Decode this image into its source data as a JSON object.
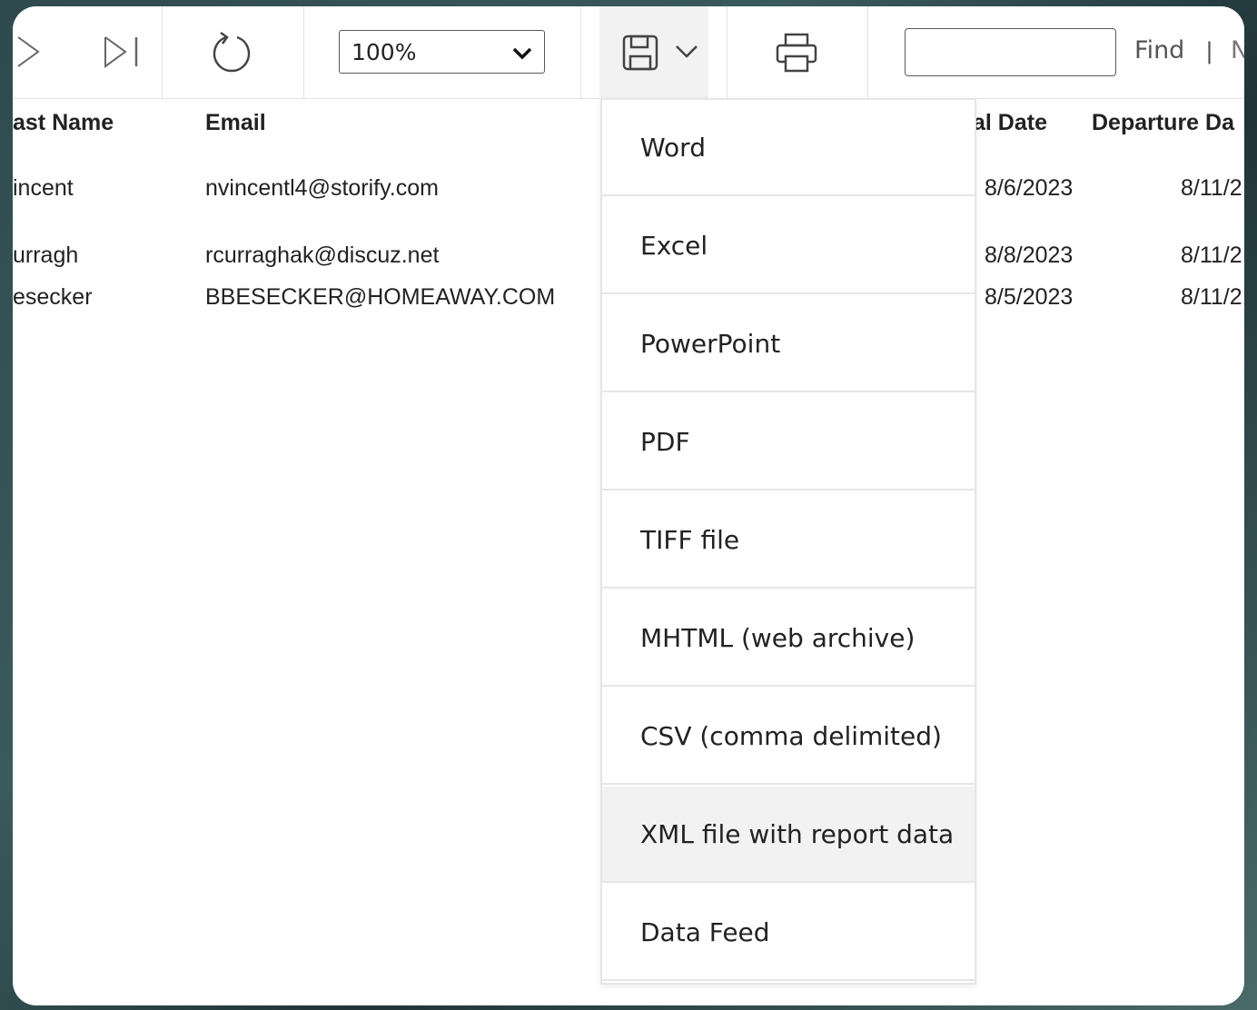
{
  "toolbar": {
    "zoom_value": "100%",
    "find_label": "Find",
    "find_separator": "|",
    "next_label": "N",
    "find_placeholder": ""
  },
  "report": {
    "headers": [
      "ast Name",
      "Email",
      "al Date",
      "Departure Da"
    ],
    "rows": [
      {
        "last_name": "incent",
        "email": "nvincentl4@storify.com",
        "arrival": "8/6/2023",
        "departure": "8/11/2"
      },
      {
        "last_name": "urragh",
        "email": "rcurraghak@discuz.net",
        "arrival": "8/8/2023",
        "departure": "8/11/2"
      },
      {
        "last_name": "esecker",
        "email": "BBESECKER@HOMEAWAY.COM",
        "arrival": "8/5/2023",
        "departure": "8/11/2"
      }
    ]
  },
  "export_menu": {
    "items": [
      "Word",
      "Excel",
      "PowerPoint",
      "PDF",
      "TIFF file",
      "MHTML (web archive)",
      "CSV (comma delimited)",
      "XML file with report data",
      "Data Feed"
    ],
    "highlighted_index": 7
  },
  "icons": {
    "next": "next-page-icon",
    "last": "last-page-icon",
    "refresh": "refresh-icon",
    "save": "save-icon",
    "dropdown": "chevron-down-icon",
    "print": "print-icon"
  }
}
